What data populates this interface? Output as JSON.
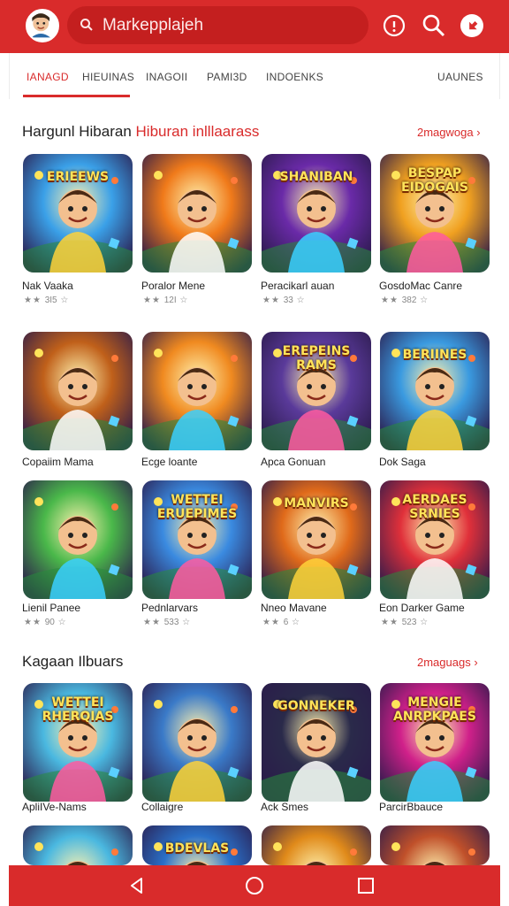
{
  "header": {
    "search_placeholder": "Markepplajeh",
    "icons": [
      "avatar",
      "info-icon",
      "search-icon",
      "profile-icon"
    ]
  },
  "tabs": [
    {
      "label": "IANAGD",
      "active": true
    },
    {
      "label": "HIEUINAS",
      "active": false
    },
    {
      "label": "INAGOII",
      "active": false
    },
    {
      "label": "PAMI3D",
      "active": false
    },
    {
      "label": "INDOENKS",
      "active": false
    },
    {
      "label": "UAUNES",
      "active": false
    }
  ],
  "section1": {
    "title": "Hargunl Hibaran",
    "subtitle": "Hiburan inlllaarass",
    "more": "2magwoga"
  },
  "section2": {
    "title": "Kagaan Ilbuars",
    "more": "2maguags"
  },
  "apps": [
    {
      "name": "Nak Vaaka",
      "rating": "3I5",
      "tile_text": "ERIEEWS"
    },
    {
      "name": "Poralor Mene",
      "rating": "12I",
      "tile_text": ""
    },
    {
      "name": "Peracikarl auan",
      "rating": "33",
      "tile_text": "SHANIBAN"
    },
    {
      "name": "GosdoMac Canre",
      "rating": "382",
      "tile_text": "BESPAP EIDOGAIS"
    },
    {
      "name": "Copaiim Mama",
      "rating": "",
      "tile_text": ""
    },
    {
      "name": "Ecge loante",
      "rating": "",
      "tile_text": ""
    },
    {
      "name": "Apca Gonuan",
      "rating": "",
      "tile_text": "EREPEINS RAMS"
    },
    {
      "name": "Dok Saga",
      "rating": "",
      "tile_text": "BERIINES"
    },
    {
      "name": "Lienil Panee",
      "rating": "90",
      "tile_text": ""
    },
    {
      "name": "Pednlarvars",
      "rating": "533",
      "tile_text": "WETTEI ERUEPIMES"
    },
    {
      "name": "Nneo Mavane",
      "rating": "6",
      "tile_text": "MANVIRS"
    },
    {
      "name": "Eon Darker Game",
      "rating": "523",
      "tile_text": "AERDAES SRNIES"
    },
    {
      "name": "ApliIVe-Nams",
      "rating": "",
      "tile_text": "WETTEI RHERQIAS"
    },
    {
      "name": "Collaigre",
      "rating": "",
      "tile_text": ""
    },
    {
      "name": "Ack Smes",
      "rating": "",
      "tile_text": "GONNEKER"
    },
    {
      "name": "ParcirBbauce",
      "rating": "",
      "tile_text": "MENGIE ANRPKPAES"
    },
    {
      "name": "",
      "rating": "",
      "tile_text": ""
    },
    {
      "name": "",
      "rating": "",
      "tile_text": "BDEVLAS"
    },
    {
      "name": "",
      "rating": "",
      "tile_text": ""
    },
    {
      "name": "",
      "rating": "",
      "tile_text": ""
    }
  ],
  "colors": {
    "accent": "#d92b2b",
    "tiles": [
      "#3aa0e8",
      "#f07a1a",
      "#6a2aa8",
      "#f0a020",
      "#c0601a",
      "#f08a20",
      "#5a3a9a",
      "#3a9ae0",
      "#4ab84a",
      "#3a8ae0",
      "#e06a1a",
      "#e0303a",
      "#4ab8e0",
      "#3a7ac8",
      "#2a2a4a",
      "#d0208a",
      "#4ab8e0",
      "#2a70c8",
      "#e08a1a",
      "#c0502a"
    ]
  },
  "navbar": {
    "icons": [
      "back-icon",
      "home-icon",
      "recents-icon"
    ]
  }
}
